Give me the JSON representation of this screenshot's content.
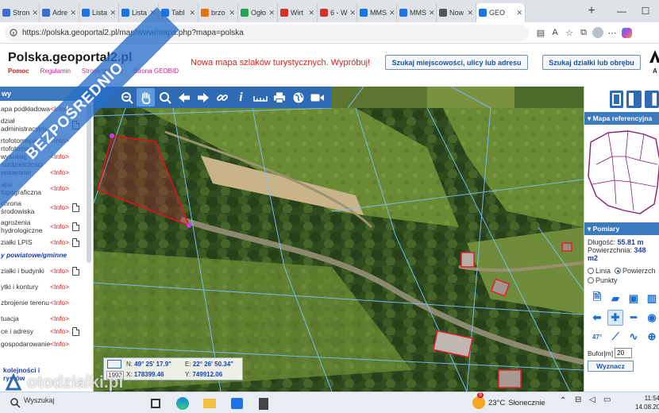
{
  "browser": {
    "tabs": [
      {
        "label": "Stron",
        "color": "#3b6fd6"
      },
      {
        "label": "Adre",
        "color": "#3b6fd6"
      },
      {
        "label": "Lista",
        "color": "#1a73e8"
      },
      {
        "label": "Lista",
        "color": "#1a73e8"
      },
      {
        "label": "Tabl",
        "color": "#1a73e8"
      },
      {
        "label": "brzo",
        "color": "#e8710a"
      },
      {
        "label": "Ogło",
        "color": "#23a455"
      },
      {
        "label": "Wirt",
        "color": "#d93025"
      },
      {
        "label": "6 - W",
        "color": "#d93025"
      },
      {
        "label": "MMS",
        "color": "#1a73e8"
      },
      {
        "label": "MMS",
        "color": "#1a73e8"
      },
      {
        "label": "Now",
        "color": "#555"
      },
      {
        "label": "GEO",
        "color": "#1a73e8"
      }
    ],
    "new_tab": "+",
    "url": "https://polska.geoportal2.pl/map/www/mapa.php?mapa=polska"
  },
  "site": {
    "logo": "Polska.geoportal2.pl",
    "links": {
      "help": "Pomoc",
      "rules": "Regulamin",
      "home": "Strona główna",
      "geobid": "Strona GEOBID"
    },
    "promo": "Nowa mapa szlaków turystycznych. Wypróbuj!",
    "search_place_button": "Szukaj miejscowości, ulicy lub adresu",
    "search_parcel_button": "Szukaj działki lub obrębu",
    "corner_label": "A"
  },
  "left_panel": {
    "title": "wy",
    "layers": [
      {
        "name": "apa podkładowa",
        "info": "<Info>",
        "doc": false
      },
      {
        "name": "dział administracyjny",
        "info": "",
        "doc": true
      },
      {
        "name": "rtofotomapa",
        "info": "<Info>",
        "doc": false
      },
      {
        "name": "rtofotomapa wysokiej rozdzielczości",
        "info": "<Info>",
        "doc": false
      },
      {
        "name": "eniowanie",
        "info": "<Info>",
        "doc": false
      },
      {
        "name": "apa topograficzna",
        "info": "<Info>",
        "doc": false
      },
      {
        "name": "chrona środowiska",
        "info": "<Info>",
        "doc": true
      },
      {
        "name": "agrożenia hydrologiczne",
        "info": "<Info>",
        "doc": true
      },
      {
        "name": "ziałki LPIS",
        "info": "<Info>",
        "doc": true
      },
      {
        "name": "y powiatowe/gminne",
        "info": "",
        "doc": false,
        "italic": true
      },
      {
        "name": "ziałki i budynki",
        "info": "<Info>",
        "doc": true
      },
      {
        "name": "ytki i kontury",
        "info": "<Info>",
        "doc": false
      },
      {
        "name": "zbrojenie terenu",
        "info": "<Info>",
        "doc": false
      },
      {
        "name": "tuacja",
        "info": "<Info>",
        "doc": false
      },
      {
        "name": "ce i adresy",
        "info": "<Info>",
        "doc": true
      },
      {
        "name": "gospodarowanie",
        "info": "<Info>",
        "doc": false
      }
    ],
    "bottom_text": "kolejności i rystów"
  },
  "coords": {
    "lat_label": "N:",
    "lat": "49° 25' 17.9\"",
    "lon_label": "E:",
    "lon": "22° 26' 50.34\"",
    "system": "1992",
    "x_label": "X:",
    "x": "178399.46",
    "y_label": "Y:",
    "y": "749912.06"
  },
  "right_panel": {
    "ref_title": "Mapa referencyjna",
    "measure_title": "Pomiary",
    "length_label": "Długość:",
    "length": "55.81 m",
    "area_label": "Powierzchnia:",
    "area": "348 m2",
    "mode_line": "Linia",
    "mode_area": "Powierzch",
    "mode_points": "Punkty",
    "buffer_label": "Bufor[m]",
    "buffer_value": "20",
    "compute_button": "Wyznacz"
  },
  "overlay": {
    "banner": "BEZPOŚREDNIO",
    "watermark": "otodzialki.pl"
  },
  "taskbar": {
    "search": "Wyszukaj",
    "weather_temp": "23°C",
    "weather_desc": "Słonecznie",
    "time": "11:54",
    "date": "14.08.20",
    "badge": "9"
  }
}
